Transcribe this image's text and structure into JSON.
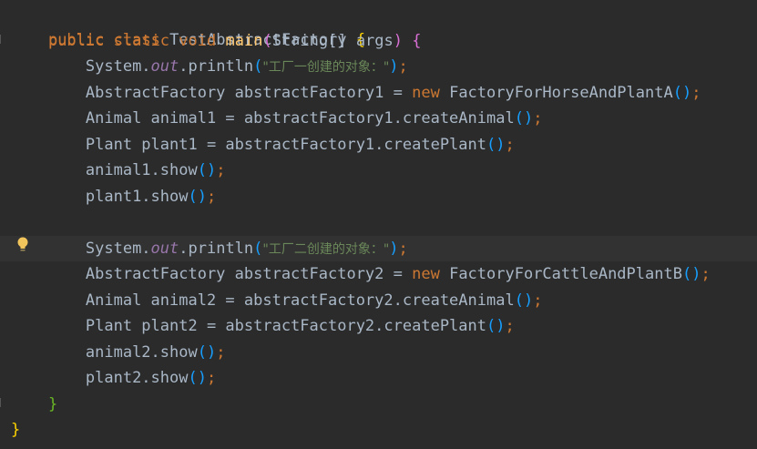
{
  "editor": {
    "class_line": {
      "kw_public": "public",
      "kw_class": "class",
      "class_name": "TestAbstractFactory",
      "brace_open": "{"
    },
    "main_line": {
      "kw_public": "public",
      "kw_static": "static",
      "kw_void": "void",
      "method_name": "main",
      "paren_open": "(",
      "params": "String[] args",
      "paren_close": ")",
      "brace_open": "{"
    },
    "block1": {
      "print_prefix": "System.",
      "print_field": "out",
      "print_method": ".println",
      "print_paren_open": "(",
      "print_string": "\"工厂一创建的对象：\"",
      "print_paren_close": ")",
      "factory_decl": "AbstractFactory abstractFactory1 = ",
      "factory_new": "new",
      "factory_ctor": " FactoryForHorseAndPlantA",
      "animal_decl": "Animal animal1 = abstractFactory1.createAnimal",
      "plant_decl": "Plant plant1 = abstractFactory1.createPlant",
      "animal_show": "animal1.show",
      "plant_show": "plant1.show"
    },
    "block2": {
      "print_prefix": "System.",
      "print_field": "out",
      "print_method": ".println",
      "print_paren_open": "(",
      "print_string": "\"工厂二创建的对象：\"",
      "print_paren_close": ")",
      "factory_decl": "AbstractFactory abstractFactory2 = ",
      "factory_new": "new",
      "factory_ctor": " FactoryForCattleAndPlantB",
      "animal_decl": "Animal animal2 = abstractFactory2.createAnimal",
      "plant_decl": "Plant plant2 = abstractFactory2.createPlant",
      "animal_show": "animal2.show",
      "plant_show": "plant2.show"
    },
    "call_parens": "()",
    "semicolon": ";",
    "main_close": "}",
    "class_close": "}"
  },
  "colors": {
    "background": "#2b2b2b",
    "keyword": "#cc7832",
    "method": "#ffc66d",
    "string": "#6a8759",
    "field": "#9876aa",
    "text": "#a9b7c6"
  },
  "icons": {
    "intention": "lightbulb-icon",
    "fold": "fold-marker-icon"
  }
}
